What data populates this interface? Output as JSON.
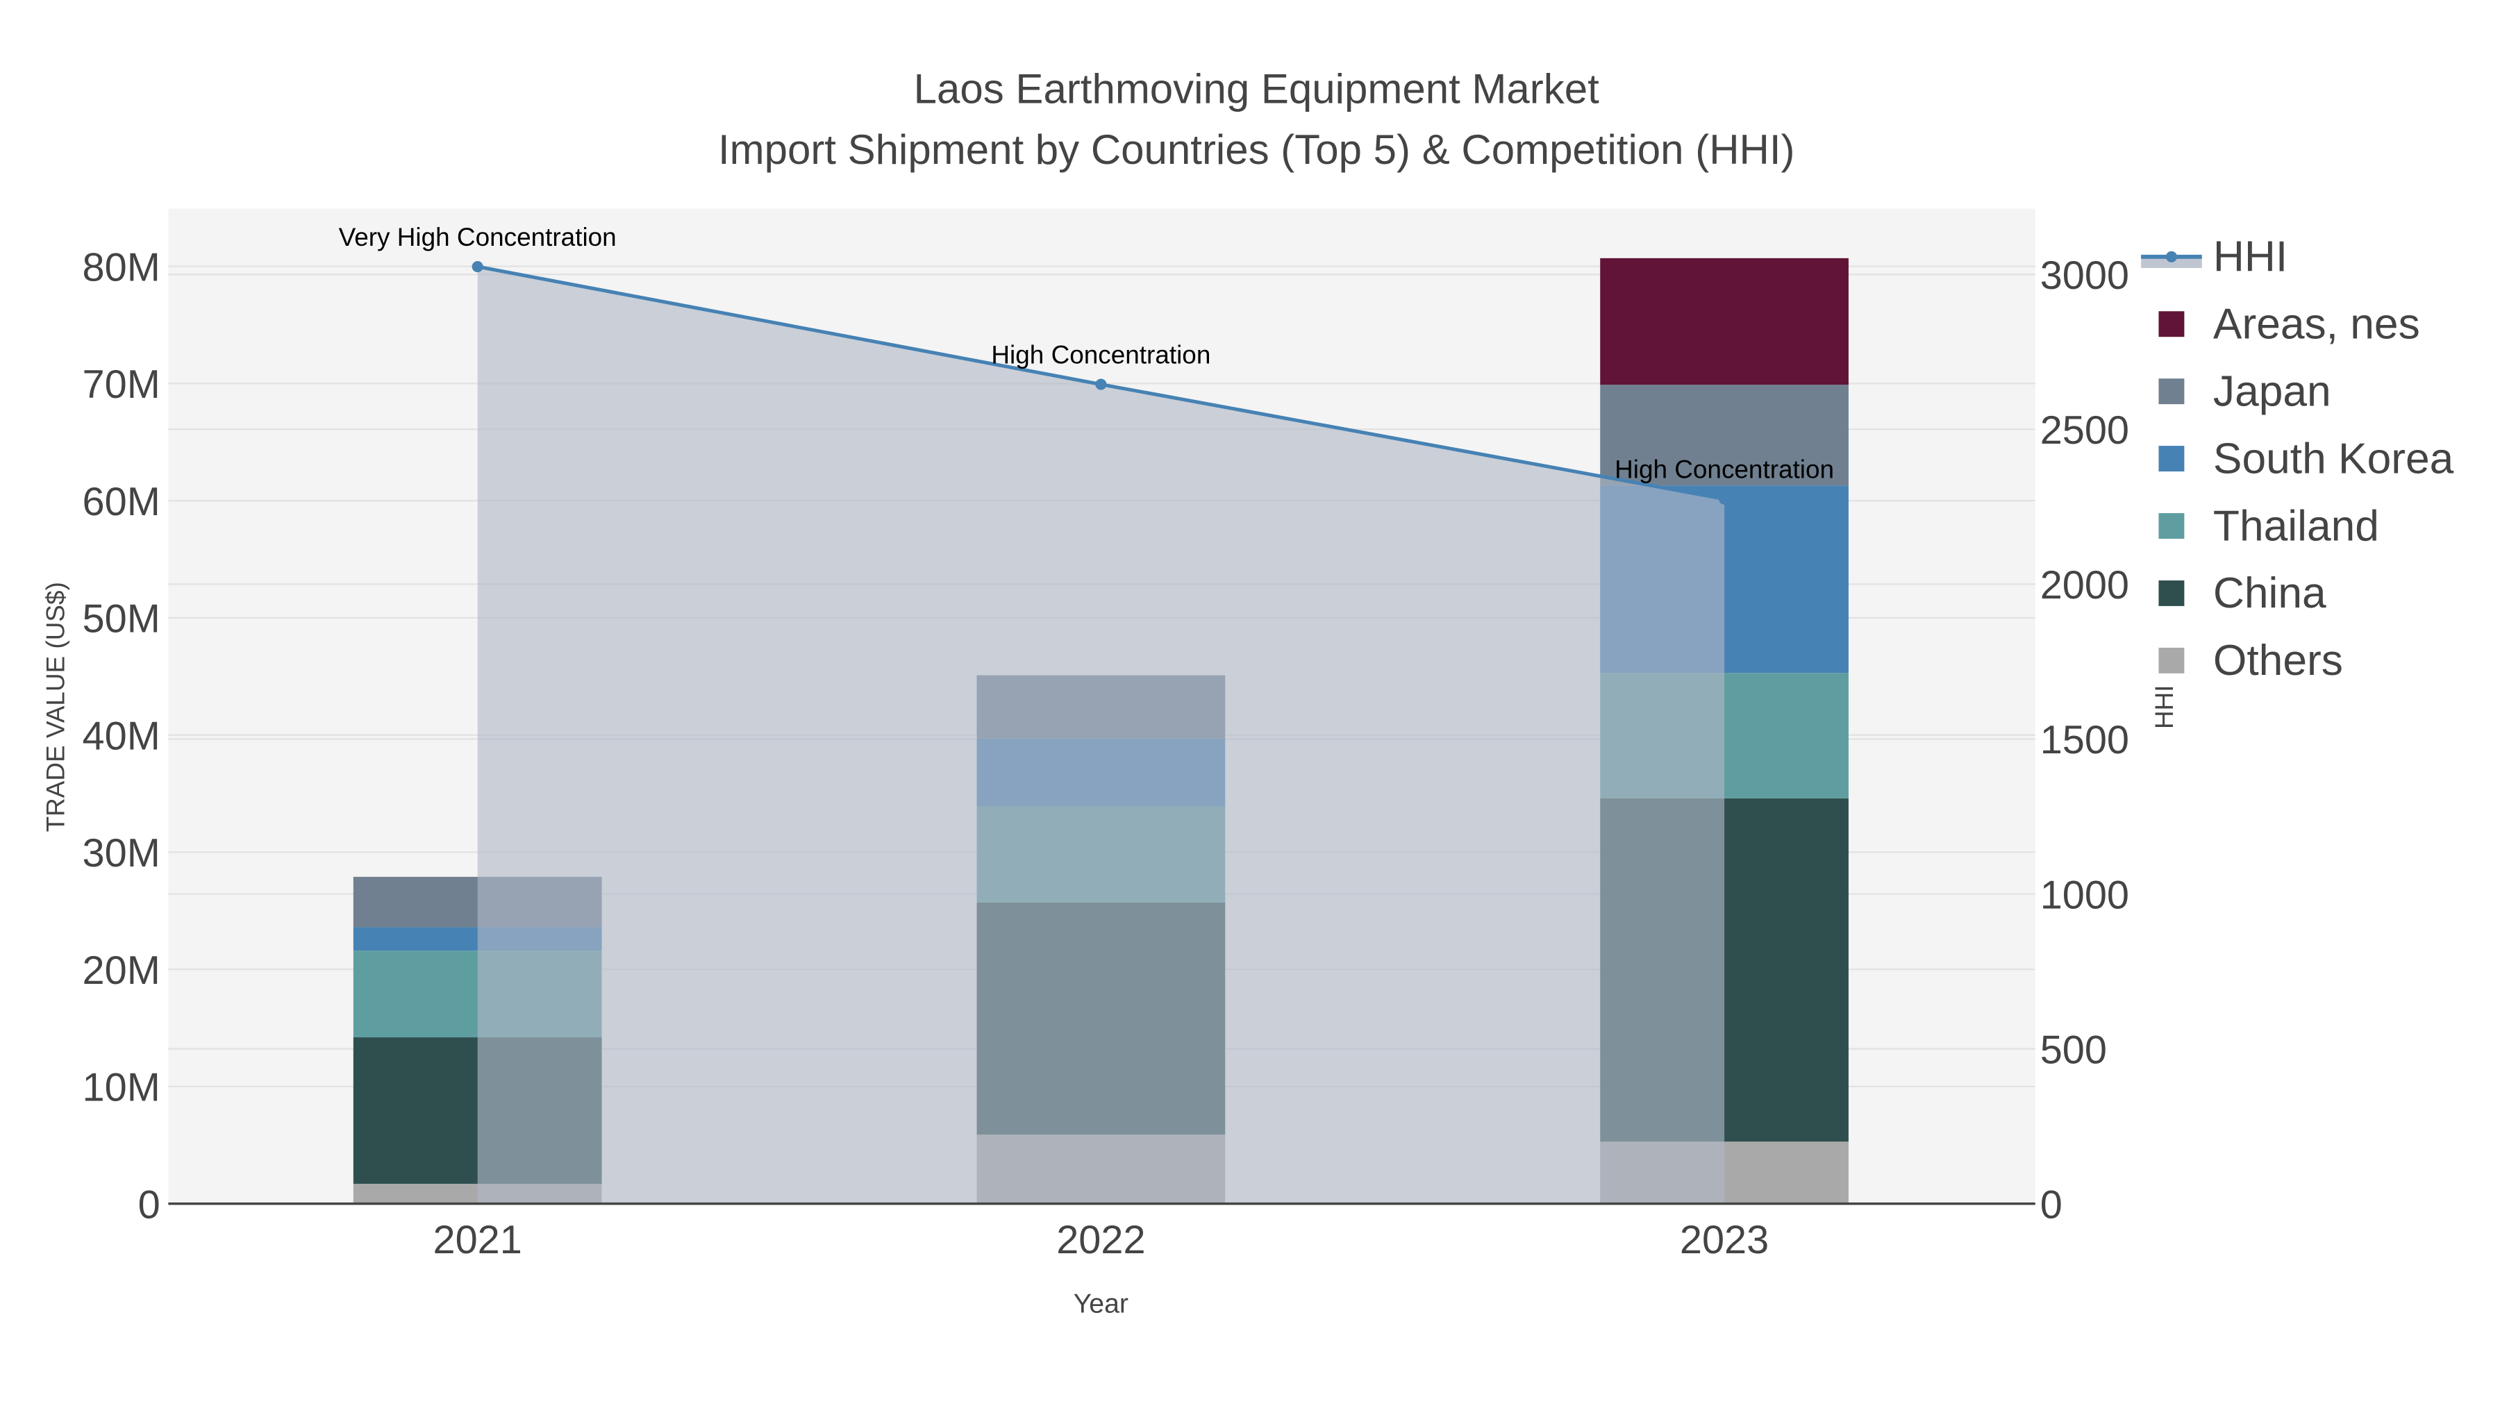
{
  "chart_data": {
    "type": "bar",
    "stacked": true,
    "title": "Laos Earthmoving Equipment Market",
    "subtitle": "Import Shipment by Countries (Top 5) & Competition (HHI)",
    "xlabel": "Year",
    "ylabel": "TRADE VALUE (US$)",
    "y2label": "HHI",
    "categories": [
      "2021",
      "2022",
      "2023"
    ],
    "ylim": [
      0,
      85000000
    ],
    "y2lim": [
      0,
      3200
    ],
    "yticks": [
      0,
      10000000,
      20000000,
      30000000,
      40000000,
      50000000,
      60000000,
      70000000,
      80000000
    ],
    "ytick_labels": [
      "0",
      "10M",
      "20M",
      "30M",
      "40M",
      "50M",
      "60M",
      "70M",
      "80M"
    ],
    "y2ticks": [
      0,
      500,
      1000,
      1500,
      2000,
      2500,
      3000
    ],
    "y2tick_labels": [
      "0",
      "500",
      "1000",
      "1500",
      "2000",
      "2500",
      "3000"
    ],
    "grid": true,
    "legend_position": "right",
    "series": [
      {
        "name": "Others",
        "color": "#a9a9a9",
        "values": [
          1700000,
          5900000,
          5300000
        ]
      },
      {
        "name": "China",
        "color": "#2f4f4f",
        "values": [
          12500000,
          19800000,
          29300000
        ]
      },
      {
        "name": "Thailand",
        "color": "#5f9ea0",
        "values": [
          7400000,
          8200000,
          10700000
        ]
      },
      {
        "name": "South Korea",
        "color": "#4682b4",
        "values": [
          2000000,
          5800000,
          16000000
        ]
      },
      {
        "name": "Japan",
        "color": "#708090",
        "values": [
          4300000,
          5400000,
          8600000
        ]
      },
      {
        "name": "Areas, nes",
        "color": "#611436",
        "values": [
          0,
          0,
          10800000
        ]
      }
    ],
    "hhi": {
      "name": "HHI",
      "color": "#4682b4",
      "values": [
        3025,
        2645,
        2275
      ],
      "annotations": [
        "Very High Concentration",
        "High Concentration",
        "High Concentration"
      ]
    },
    "legend_order": [
      "HHI",
      "Areas, nes",
      "Japan",
      "South Korea",
      "Thailand",
      "China",
      "Others"
    ]
  }
}
